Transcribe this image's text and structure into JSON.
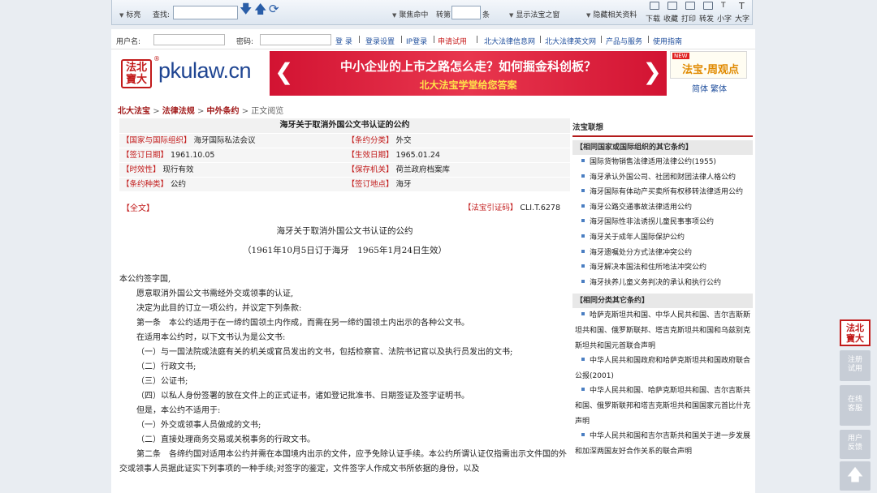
{
  "toolbar": {
    "title_label": "标亮",
    "search_label": "查找:",
    "focus_label": "聚焦命中",
    "jump_label": "转第",
    "jump_unit": "条",
    "show_window_label": "显示法宝之窗",
    "hide_related_label": "隐藏相关资料",
    "actions": [
      "下载",
      "收藏",
      "打印",
      "转发",
      "小字",
      "大字"
    ]
  },
  "loginbar": {
    "username_label": "用户名:",
    "password_label": "密码:",
    "login": "登 录",
    "links": [
      "登录设置",
      "IP登录"
    ],
    "trial": "申请试用",
    "sites": [
      "北大法律信息网",
      "北大法律英文网",
      "产品与服务",
      "使用指南"
    ]
  },
  "logo": {
    "seal_line1": "法北",
    "seal_line2": "寶大",
    "text": "pkulaw.cn",
    "reg": "®"
  },
  "banner": {
    "line1": "中小企业的上市之路怎么走？如何掘金科创板？",
    "line2": "北大法宝学堂给您答案"
  },
  "side_banner": {
    "badge": "NEW",
    "text": "法宝·周观点",
    "simplified": "简体",
    "traditional": "繁体"
  },
  "breadcrumb": {
    "items": [
      "北大法宝",
      "法律法规",
      "中外条约"
    ],
    "current": "正文阅览",
    "sep": ">"
  },
  "document": {
    "title": "海牙关于取消外国公文书认证的公约",
    "meta": [
      [
        {
          "key": "【国家与国际组织】",
          "value": "海牙国际私法会议"
        },
        {
          "key": "【条约分类】",
          "value": "外交"
        }
      ],
      [
        {
          "key": "【签订日期】",
          "value": "1961.10.05"
        },
        {
          "key": "【生效日期】",
          "value": "1965.01.24"
        }
      ],
      [
        {
          "key": "【时效性】",
          "value": "现行有效"
        },
        {
          "key": "【保存机关】",
          "value": "荷兰政府档案库"
        }
      ],
      [
        {
          "key": "【条约种类】",
          "value": "公约"
        },
        {
          "key": "【签订地点】",
          "value": "海牙"
        }
      ]
    ],
    "fulltext_label": "【全文】",
    "cite_key": "【法宝引证码】",
    "cite_value": "CLI.T.6278",
    "body_title": "海牙关于取消外国公文书认证的公约",
    "body_date": "（1961年10月5日订于海牙　1965年1月24日生效）",
    "paragraphs": [
      {
        "text": "本公约签字国,",
        "style": ""
      },
      {
        "text": "愿意取消外国公文书需经外交或领事的认证,",
        "style": "ind"
      },
      {
        "text": "决定为此目的订立一项公约，并议定下列条款:",
        "style": "ind"
      },
      {
        "text": "第一条　本公约适用于在一缔约国领土内作成，而需在另一缔约国领土内出示的各种公文书。",
        "style": "ind"
      },
      {
        "text": "在适用本公约时，以下文书认为是公文书:",
        "style": "ind"
      },
      {
        "text": "（一）与一国法院或法庭有关的机关或官员发出的文书，包括检察官、法院书记官以及执行员发出的文书;",
        "style": "ind"
      },
      {
        "text": "（二）行政文书;",
        "style": "ind"
      },
      {
        "text": "（三）公证书;",
        "style": "ind"
      },
      {
        "text": "（四）以私人身份签署的放在文件上的正式证书，诸如登记批准书、日期签证及签字证明书。",
        "style": "ind"
      },
      {
        "text": "但是，本公约不适用于:",
        "style": "ind"
      },
      {
        "text": "（一）外交或领事人员做成的文书;",
        "style": "ind"
      },
      {
        "text": "（二）直接处理商务交易或关税事务的行政文书。",
        "style": "ind"
      },
      {
        "text": "第二条　各缔约国对适用本公约并需在本国境内出示的文件，应予免除认证手续。本公约所谓认证仅指需出示文件国的外交或领事人员据此证实下列事项的一种手续;对签字的鉴定，文件签字人作成文书所依据的身份，以及",
        "style": "ind"
      }
    ]
  },
  "sidebar": {
    "heading": "法宝联想",
    "sections": [
      {
        "title": "【相同国家或国际组织的其它条约】",
        "items": [
          "国际货物销售法律适用法律公约(1955)",
          "海牙承认外国公司、社团和财团法律人格公约",
          "海牙国际有体动产买卖所有权移转法律适用公约",
          "海牙公路交通事故法律适用公约",
          "海牙国际性非法诱拐儿童民事事项公约",
          "海牙关于成年人国际保护公约",
          "海牙遗嘱处分方式法律冲突公约",
          "海牙解决本国法和住所地法冲突公约",
          "海牙扶养儿童义务判决的承认和执行公约"
        ]
      },
      {
        "title": "【相同分类其它条约】",
        "items": [
          "哈萨克斯坦共和国、中华人民共和国、吉尔吉斯斯坦共和国、俄罗斯联邦、塔吉克斯坦共和国和乌兹别克斯坦共和国元首联合声明",
          "中华人民共和国政府和哈萨克斯坦共和国政府联合公报(2001)",
          "中华人民共和国、哈萨克斯坦共和国、吉尔吉斯共和国、俄罗斯联邦和塔吉克斯坦共和国国家元首比什克声明",
          "中华人民共和国和吉尔吉斯共和国关于进一步发展和加深两国友好合作关系的联合声明"
        ]
      }
    ]
  },
  "float": {
    "seal_line1": "法北",
    "seal_line2": "寶大",
    "register": "注册\n试用",
    "online": "在线\n客服",
    "feedback": "用户\n反馈"
  }
}
